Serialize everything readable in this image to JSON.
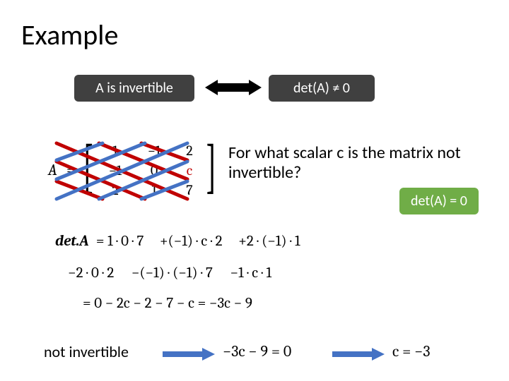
{
  "title": "Example",
  "boxes": {
    "invertible": "A is invertible",
    "detNonZero": "det(A) ≠ 0",
    "detZero": "det(A) = 0"
  },
  "question": "For what scalar c is the matrix not invertible?",
  "matrix": {
    "label": "A",
    "eq": "=",
    "rows": [
      [
        "1",
        "−1",
        "2"
      ],
      [
        "−1",
        "0",
        "c"
      ],
      [
        "2",
        "1",
        "7"
      ]
    ]
  },
  "calc": {
    "detA_label": "det.A",
    "line1_a": "= 1 · 0 · 7",
    "line1_b": "+(−1) · c · 2",
    "line1_c": "+2 · (−1) · 1",
    "line2_a": "−2 · 0 · 2",
    "line2_b": "−(−1) · (−1) · 7",
    "line2_c": "−1 · c · 1",
    "line3": "= 0 − 2c − 2 − 7 − c = −3c − 9"
  },
  "bottom": {
    "label": "not invertible",
    "eq1": "−3c − 9 = 0",
    "eq2": "c = −3"
  },
  "colors": {
    "dark": "#404040",
    "green": "#70ad47",
    "accentRed": "#c00000",
    "accentBlue": "#4472c4"
  }
}
